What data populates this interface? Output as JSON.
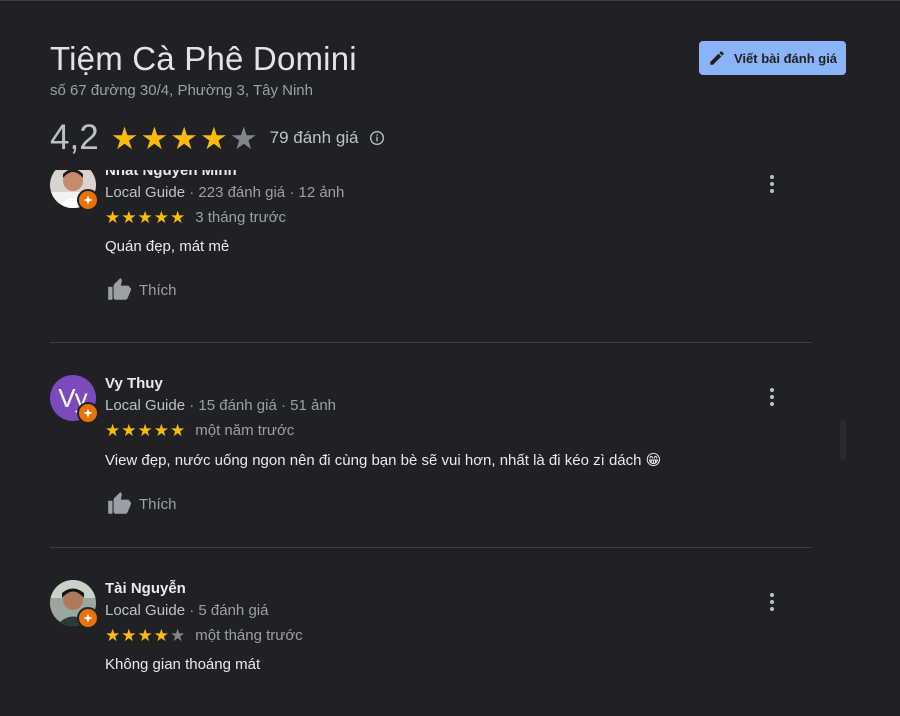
{
  "place": {
    "name": "Tiệm Cà Phê Domini",
    "address": "số 67 đường 30/4, Phường 3, Tây Ninh",
    "rating": "4,2",
    "rating_value": 4.2,
    "review_count": "79 đánh giá"
  },
  "actions": {
    "write_review": "Viết bài đánh giá"
  },
  "colors": {
    "accent": "#8ab4f8",
    "star": "#fbbc04",
    "badge": "#e8710a",
    "background": "#202124"
  },
  "reviews": [
    {
      "name": "Nhất Nguyên Minh",
      "guide": "Local Guide",
      "stats": "· 223 đánh giá · 12 ảnh",
      "stars": 5,
      "time": "3 tháng trước",
      "text": "Quán đẹp, mát mẻ",
      "like": "Thích",
      "avatar": "photo"
    },
    {
      "name": "Vy Thuy",
      "guide": "Local Guide",
      "stats": "· 15 đánh giá · 51 ảnh",
      "stars": 5,
      "time": "một năm trước",
      "text": "View đẹp, nước uống ngon nên đi cùng bạn bè sẽ vui hơn, nhất là đi kéo zì dách 😁",
      "like": "Thích",
      "avatar_letter": "Vy"
    },
    {
      "name": "Tài Nguyễn",
      "guide": "Local Guide",
      "stats": "· 5 đánh giá",
      "stars": 4,
      "time": "một tháng trước",
      "text": "Không gian thoáng mát",
      "avatar": "photo"
    }
  ]
}
